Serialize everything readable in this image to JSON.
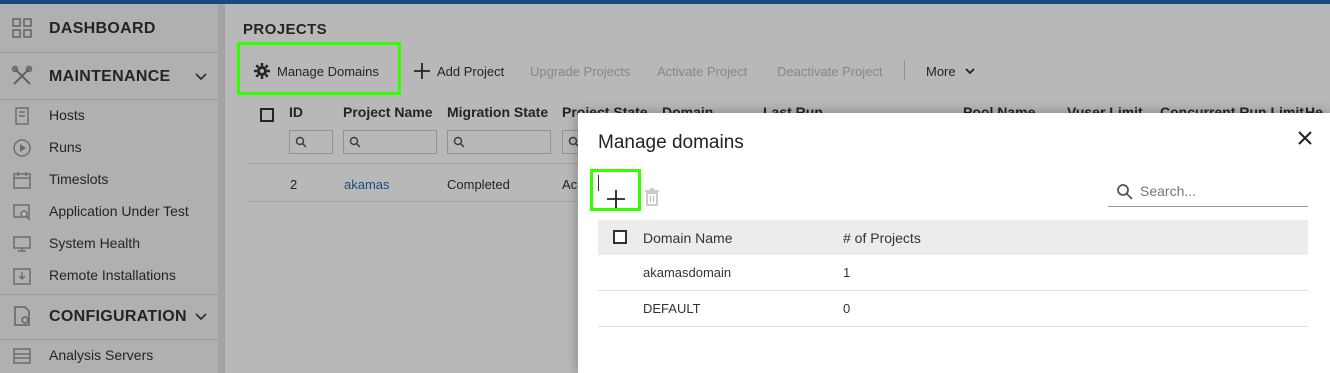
{
  "sidebar": {
    "dashboard": "DASHBOARD",
    "maintenance": "MAINTENANCE",
    "maintenance_items": [
      {
        "label": "Hosts"
      },
      {
        "label": "Runs"
      },
      {
        "label": "Timeslots"
      },
      {
        "label": "Application Under Test"
      },
      {
        "label": "System Health"
      },
      {
        "label": "Remote Installations"
      }
    ],
    "configuration": "CONFIGURATION",
    "configuration_items": [
      {
        "label": "Analysis Servers"
      }
    ]
  },
  "main": {
    "title": "PROJECTS",
    "toolbar": {
      "manage_domains": "Manage Domains",
      "add_project": "Add Project",
      "upgrade_projects": "Upgrade Projects",
      "activate_project": "Activate Project",
      "deactivate_project": "Deactivate Project",
      "more": "More"
    },
    "grid": {
      "columns": [
        "ID",
        "Project Name",
        "Migration State",
        "Project State",
        "Domain",
        "Last Run",
        "Pool Name",
        "Vuser Limit",
        "Concurrent Run Limit",
        "He"
      ],
      "rows": [
        {
          "id": "2",
          "name": "akamas",
          "migration": "Completed",
          "state": "Ac"
        }
      ]
    }
  },
  "dialog": {
    "title": "Manage domains",
    "search_placeholder": "Search...",
    "columns": {
      "domain_name": "Domain Name",
      "projects": "# of Projects"
    },
    "rows": [
      {
        "domain": "akamasdomain",
        "count": "1"
      },
      {
        "domain": "DEFAULT",
        "count": "0"
      }
    ]
  },
  "colors": {
    "accent": "#1f66b5",
    "highlight": "#33ff00",
    "link": "#1f6cb8"
  }
}
